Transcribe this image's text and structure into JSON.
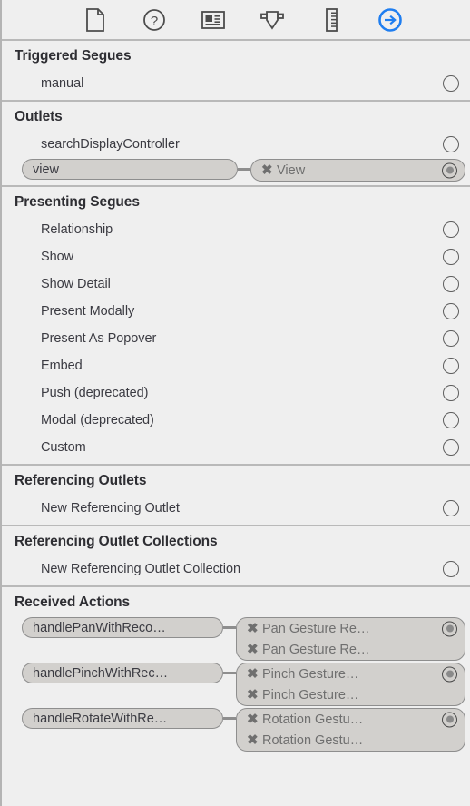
{
  "toolbar": {
    "items": [
      {
        "name": "file-inspector-icon",
        "label": "File Inspector"
      },
      {
        "name": "quick-help-inspector-icon",
        "label": "Quick Help Inspector"
      },
      {
        "name": "identity-inspector-icon",
        "label": "Identity Inspector"
      },
      {
        "name": "attributes-inspector-icon",
        "label": "Attributes Inspector"
      },
      {
        "name": "size-inspector-icon",
        "label": "Size Inspector"
      },
      {
        "name": "connections-inspector-icon",
        "label": "Connections Inspector"
      }
    ],
    "selected_index": 5,
    "accent_color": "#1f7ef0"
  },
  "sections": [
    {
      "title": "Triggered Segues",
      "rows": [
        {
          "label": "manual",
          "connected": false
        }
      ]
    },
    {
      "title": "Outlets",
      "rows": [
        {
          "label": "searchDisplayController",
          "connected": false
        },
        {
          "label": "view",
          "connected": true,
          "targets": [
            {
              "icon": "disconnect-icon",
              "label": "View"
            }
          ]
        }
      ]
    },
    {
      "title": "Presenting Segues",
      "rows": [
        {
          "label": "Relationship",
          "connected": false
        },
        {
          "label": "Show",
          "connected": false
        },
        {
          "label": "Show Detail",
          "connected": false
        },
        {
          "label": "Present Modally",
          "connected": false
        },
        {
          "label": "Present As Popover",
          "connected": false
        },
        {
          "label": "Embed",
          "connected": false
        },
        {
          "label": "Push (deprecated)",
          "connected": false
        },
        {
          "label": "Modal (deprecated)",
          "connected": false
        },
        {
          "label": "Custom",
          "connected": false
        }
      ]
    },
    {
      "title": "Referencing Outlets",
      "rows": [
        {
          "label": "New Referencing Outlet",
          "connected": false
        }
      ]
    },
    {
      "title": "Referencing Outlet Collections",
      "rows": [
        {
          "label": "New Referencing Outlet Collection",
          "connected": false
        }
      ]
    },
    {
      "title": "Received Actions",
      "rows": [
        {
          "label": "handlePanWithReco…",
          "connected": true,
          "targets": [
            {
              "icon": "disconnect-icon",
              "label": "Pan Gesture Re…"
            },
            {
              "icon": "disconnect-icon",
              "label": "Pan Gesture Re…"
            }
          ]
        },
        {
          "label": "handlePinchWithRec…",
          "connected": true,
          "targets": [
            {
              "icon": "disconnect-icon",
              "label": "Pinch Gesture…"
            },
            {
              "icon": "disconnect-icon",
              "label": "Pinch Gesture…"
            }
          ]
        },
        {
          "label": "handleRotateWithRe…",
          "connected": true,
          "targets": [
            {
              "icon": "disconnect-icon",
              "label": "Rotation Gestu…"
            },
            {
              "icon": "disconnect-icon",
              "label": "Rotation Gestu…"
            }
          ]
        }
      ]
    }
  ],
  "glyphs": {
    "disconnect": "✖"
  }
}
